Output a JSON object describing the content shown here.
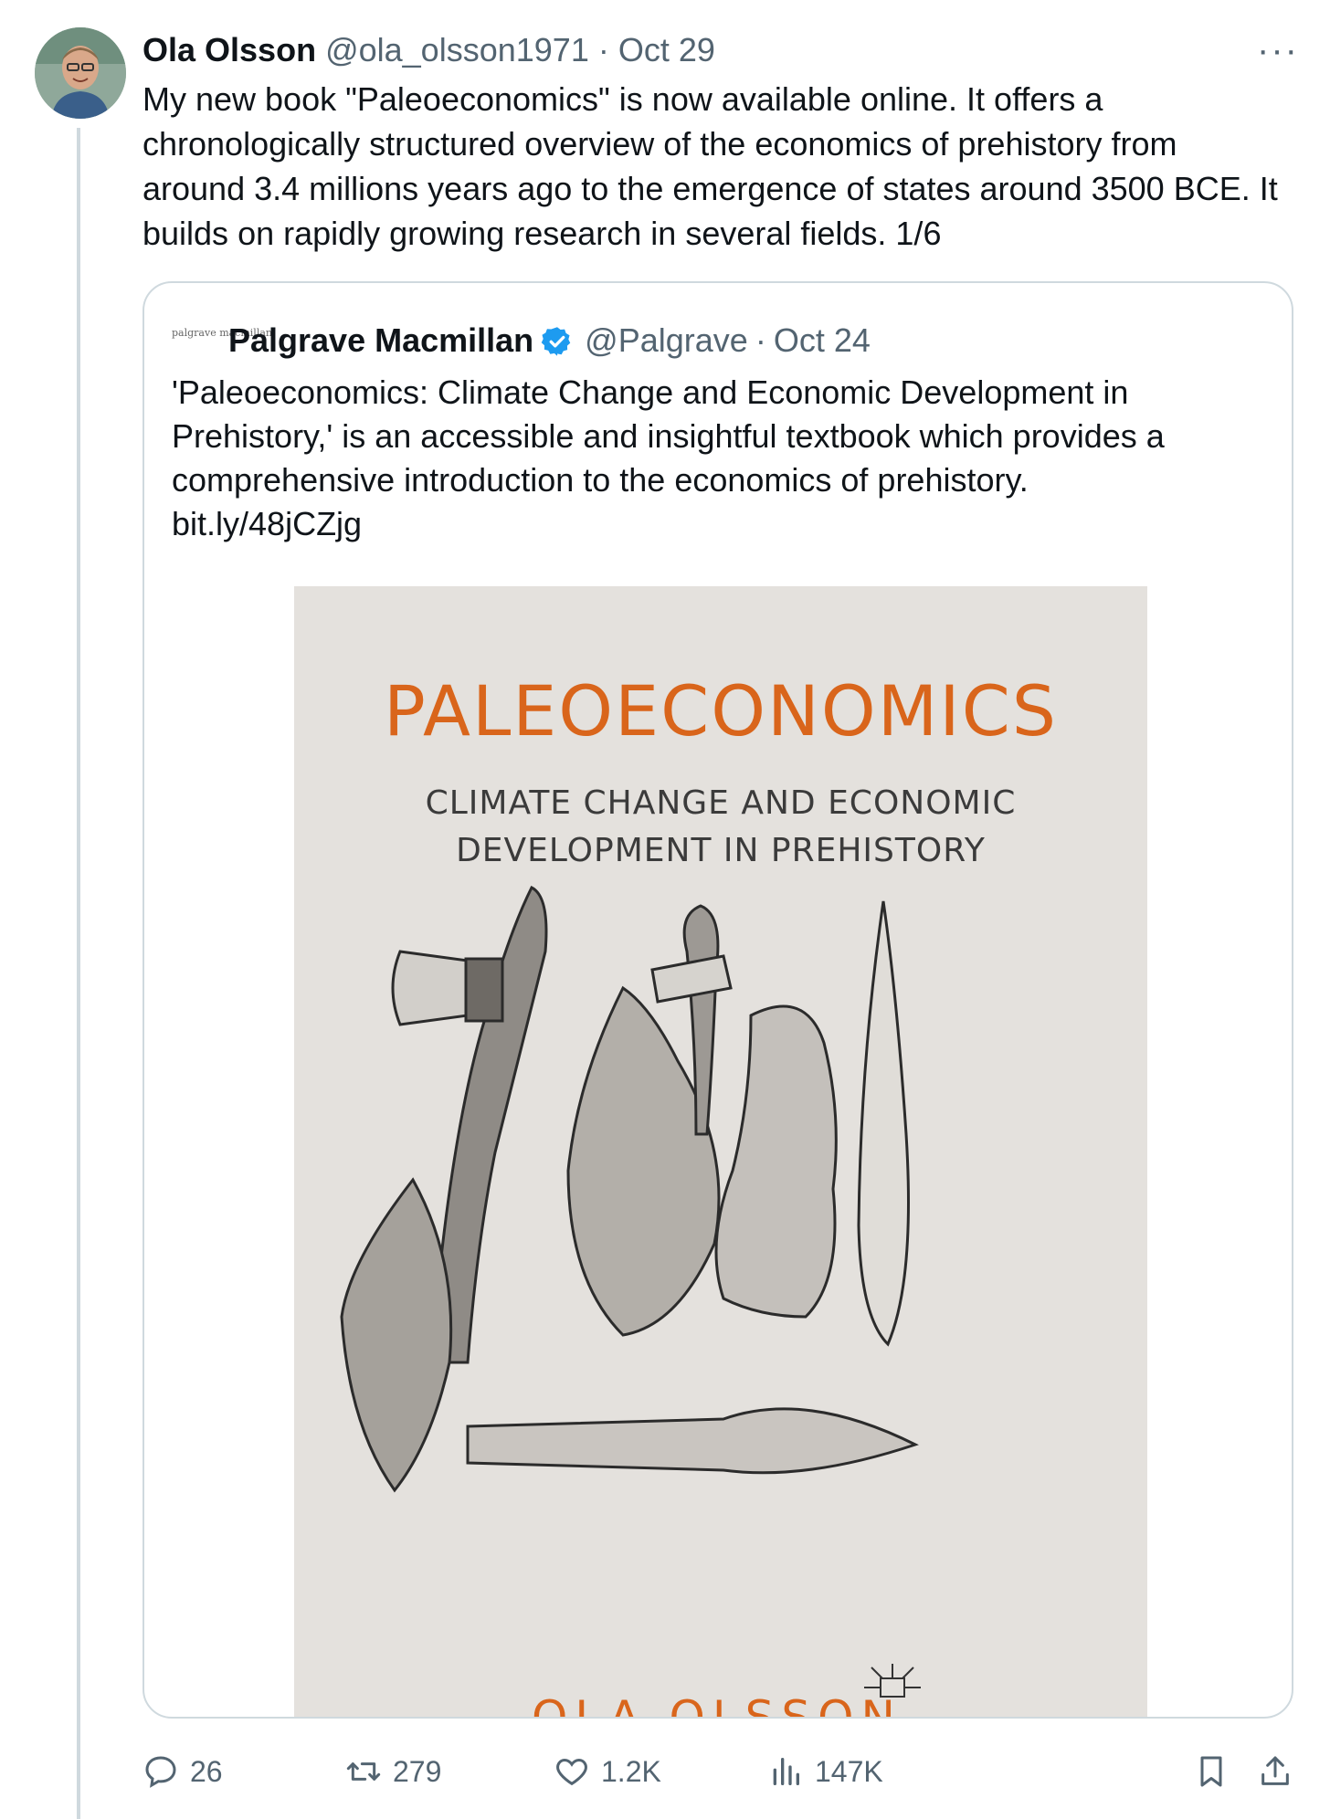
{
  "author": {
    "name": "Ola Olsson",
    "handle": "@ola_olsson1971",
    "separator": "·",
    "date": "Oct 29"
  },
  "tweet": {
    "text": "My new book \"Paleoeconomics\" is now available online. It offers a chronologically structured overview of the economics of prehistory from around 3.4 millions years ago to the emergence of states around 3500 BCE. It builds on rapidly growing research in several fields. 1/6"
  },
  "more_label": "···",
  "quote": {
    "logo_text": "palgrave macmillan",
    "name": "Palgrave Macmillan",
    "handle": "@Palgrave",
    "separator": "·",
    "date": "Oct 24",
    "text": "'Paleoeconomics: Climate Change and Economic Development in Prehistory,' is an accessible and insightful textbook which provides a comprehensive introduction to the economics of prehistory.",
    "link": "bit.ly/48jCZjg",
    "cover": {
      "title": "PALEOECONOMICS",
      "subtitle_line1": "CLIMATE CHANGE AND ECONOMIC",
      "subtitle_line2": "DEVELOPMENT IN PREHISTORY",
      "author": "OLA OLSSON"
    }
  },
  "actions": {
    "replies": "26",
    "reposts": "279",
    "likes": "1.2K",
    "views": "147K"
  },
  "colors": {
    "text_primary": "#0f1419",
    "text_secondary": "#536471",
    "border": "#cfd9de",
    "verified": "#1d9bf0",
    "cover_bg": "#e4e1dd",
    "cover_accent": "#d9651b"
  }
}
